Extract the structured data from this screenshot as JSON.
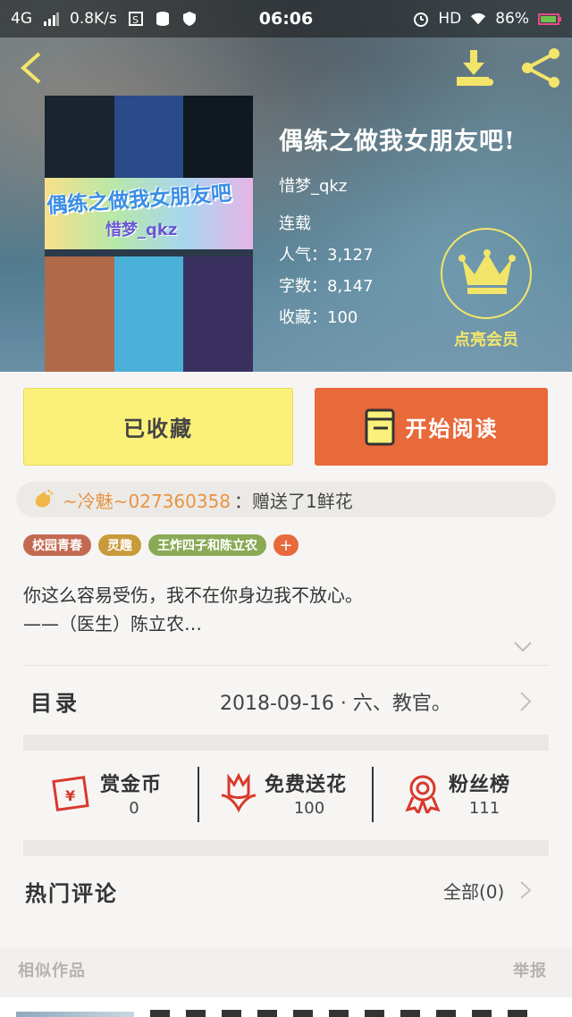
{
  "status_bar": {
    "network": "4G",
    "speed": "0.8K/s",
    "time": "06:06",
    "hd": "HD",
    "battery": "86%"
  },
  "header": {
    "back_icon": "back-chevron-icon",
    "download_icon": "download-icon",
    "share_icon": "share-icon"
  },
  "cover": {
    "title_text": "偶练之做我女朋友吧",
    "author_text": "惜梦_qkz"
  },
  "book": {
    "title": "偶练之做我女朋友吧!",
    "author": "惜梦_qkz",
    "status": "连载",
    "popularity": "人气：3,127",
    "word_count": "字数：8,147",
    "favorites": "收藏：100",
    "vip_label": "点亮会员"
  },
  "actions": {
    "collected_label": "已收藏",
    "read_label": "开始阅读"
  },
  "gift": {
    "user": "~冷魅~027360358",
    "message": "：赠送了1鲜花"
  },
  "tags": [
    {
      "label": "校园青春",
      "color": "#c46a52"
    },
    {
      "label": "灵趣",
      "color": "#c89a3a"
    },
    {
      "label": "王炸四子和陈立农",
      "color": "#8aaa56"
    }
  ],
  "tag_add_label": "+",
  "intro": {
    "line1": "你这么容易受伤，我不在你身边我不放心。",
    "line2": "——（医生）陈立农…"
  },
  "catalog": {
    "label": "目录",
    "latest": "2018-09-16 · 六、教官。"
  },
  "stats": [
    {
      "label": "赏金币",
      "value": "0",
      "icon": "red-envelope-icon"
    },
    {
      "label": "免费送花",
      "value": "100",
      "icon": "flower-icon"
    },
    {
      "label": "粉丝榜",
      "value": "111",
      "icon": "medal-icon"
    }
  ],
  "comments": {
    "title": "热门评论",
    "all_label": "全部(0)"
  },
  "similar": {
    "label": "相似作品",
    "report_label": "举报"
  },
  "colors": {
    "accent_orange": "#e8693a",
    "button_yellow": "#fbf17a",
    "vip_yellow": "#f3e56a",
    "gift_user_orange": "#e89343"
  }
}
